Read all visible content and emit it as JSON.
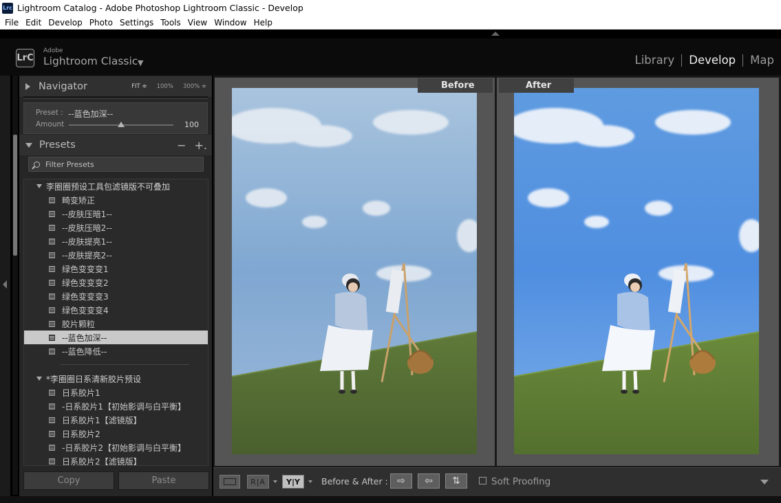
{
  "window": {
    "title": "Lightroom Catalog - Adobe Photoshop Lightroom Classic - Develop",
    "app_icon": "Lrc"
  },
  "menu": [
    "File",
    "Edit",
    "Develop",
    "Photo",
    "Settings",
    "Tools",
    "View",
    "Window",
    "Help"
  ],
  "identity": {
    "logo": "LrC",
    "adobe": "Adobe",
    "product": "Lightroom Classic",
    "modules": [
      "Library",
      "Develop",
      "Map"
    ],
    "active_module": "Develop"
  },
  "navigator": {
    "title": "Navigator",
    "fit": "FIT ≑",
    "z1": "100%",
    "z2": "300% ≑"
  },
  "preset_amount": {
    "preset_label": "Preset :",
    "preset_value": "--蓝色加深--",
    "amount_label": "Amount",
    "amount_value": "100",
    "amount_fraction": 0.5
  },
  "presets": {
    "title": "Presets",
    "minus": "−",
    "plus": "+.",
    "filter_placeholder": "Filter Presets",
    "groups": [
      {
        "name": "李圈圈预设工具包滤镜版不可叠加",
        "items": [
          "畸变矫正",
          "--皮肤压暗1--",
          "--皮肤压暗2--",
          "--皮肤提亮1--",
          "--皮肤提亮2--",
          "绿色变变变1",
          "绿色变变变2",
          "绿色变变变3",
          "绿色变变变4",
          "胶片颗粒",
          "--蓝色加深--",
          "--蓝色降低--"
        ]
      },
      {
        "name": "*李圈圈日系清新胶片预设",
        "items": [
          "日系胶片1",
          "-日系胶片1【初始影调与白平衡】",
          "日系胶片1【滤镜版】",
          "日系胶片2",
          "-日系胶片2【初始影调与白平衡】",
          "日系胶片2【滤镜版】"
        ]
      }
    ],
    "selected": "--蓝色加深--"
  },
  "buttons": {
    "copy": "Copy",
    "paste": "Paste"
  },
  "view": {
    "before": "Before",
    "after": "After"
  },
  "toolbar": {
    "ra": "R|A",
    "yy": "Y|Y",
    "before_after": "Before & After :",
    "swap1": "⇨",
    "swap2": "⇦",
    "swap3": "⇅",
    "soft_proofing": "Soft Proofing"
  }
}
